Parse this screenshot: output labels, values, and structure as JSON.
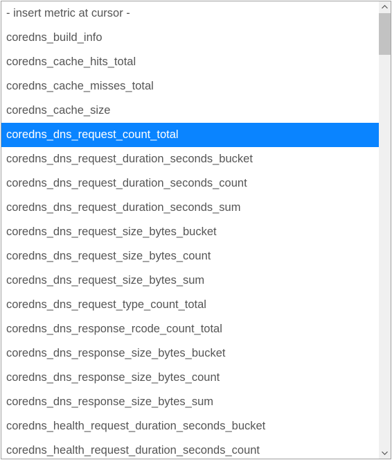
{
  "dropdown": {
    "placeholder": "- insert metric at cursor -",
    "selected_index": 5,
    "options": [
      "coredns_build_info",
      "coredns_cache_hits_total",
      "coredns_cache_misses_total",
      "coredns_cache_size",
      "coredns_dns_request_count_total",
      "coredns_dns_request_duration_seconds_bucket",
      "coredns_dns_request_duration_seconds_count",
      "coredns_dns_request_duration_seconds_sum",
      "coredns_dns_request_size_bytes_bucket",
      "coredns_dns_request_size_bytes_count",
      "coredns_dns_request_size_bytes_sum",
      "coredns_dns_request_type_count_total",
      "coredns_dns_response_rcode_count_total",
      "coredns_dns_response_size_bytes_bucket",
      "coredns_dns_response_size_bytes_count",
      "coredns_dns_response_size_bytes_sum",
      "coredns_health_request_duration_seconds_bucket",
      "coredns_health_request_duration_seconds_count"
    ]
  },
  "colors": {
    "highlight": "#0a84ff",
    "text": "#555555",
    "border": "#9f9f9f",
    "scrollbar_track": "#f0f0f0",
    "scrollbar_thumb": "#c2c2c2"
  }
}
